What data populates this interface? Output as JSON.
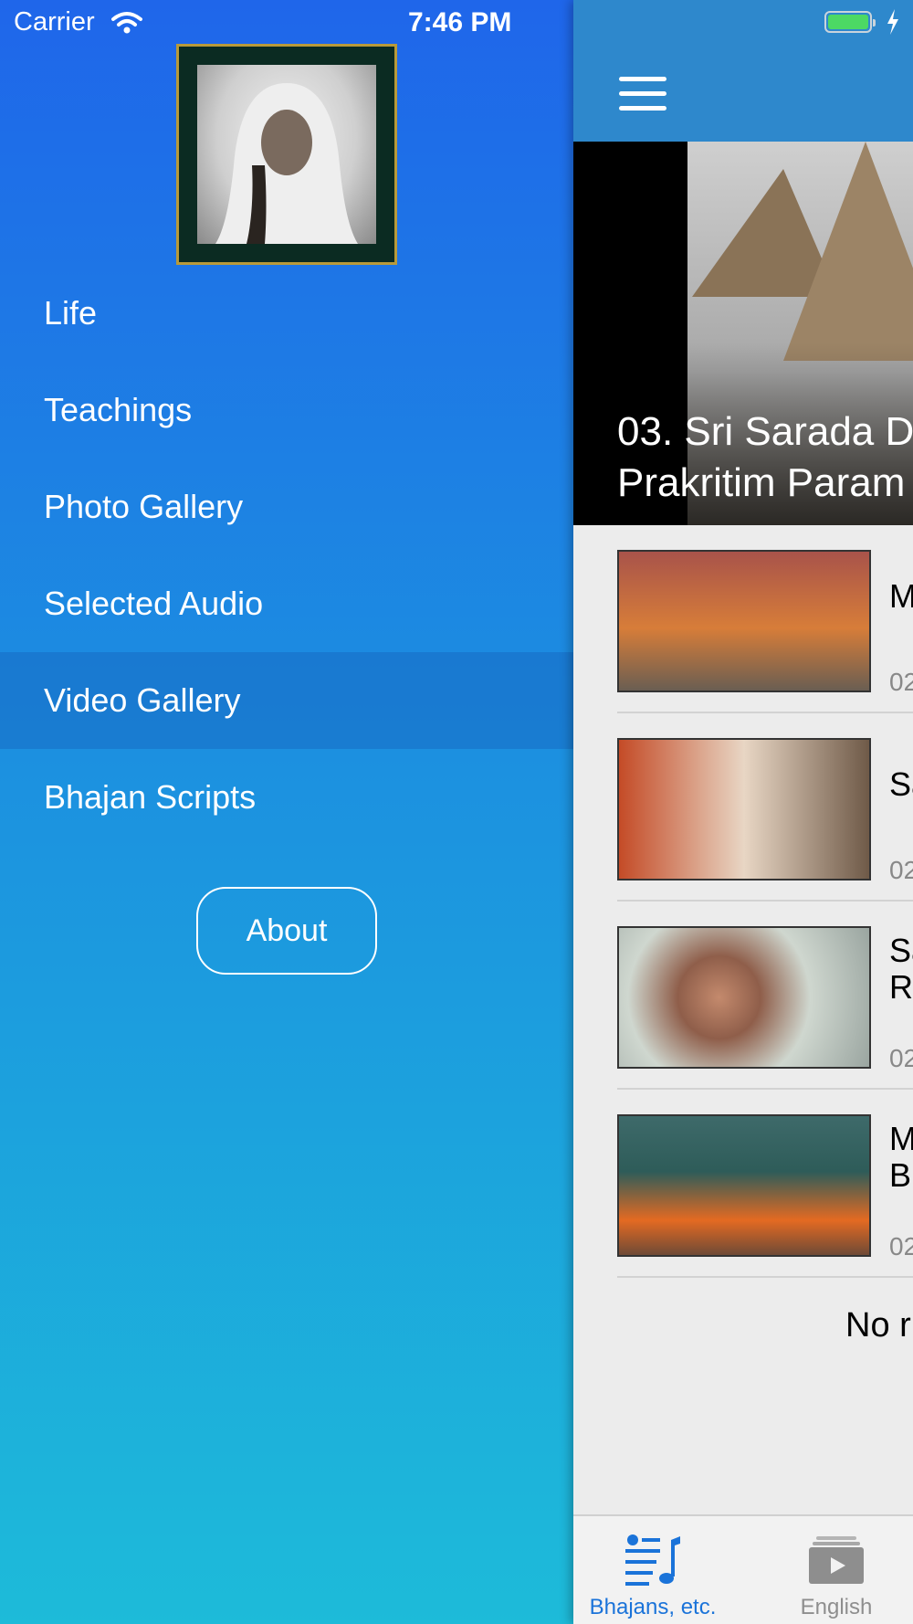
{
  "status_bar": {
    "carrier": "Carrier",
    "time": "7:46 PM"
  },
  "drawer": {
    "menu": [
      {
        "label": "Life"
      },
      {
        "label": "Teachings"
      },
      {
        "label": "Photo Gallery"
      },
      {
        "label": "Selected Audio"
      },
      {
        "label": "Video Gallery",
        "selected": true
      },
      {
        "label": "Bhajan Scripts"
      }
    ],
    "about_label": "About",
    "colors": {
      "gradient_top": "#1f66ea",
      "gradient_bottom": "#1dbbd9"
    }
  },
  "content": {
    "navbar_color": "#2e88cc",
    "hero_title_line1": "03. Sri Sarada D",
    "hero_title_line2": "Prakritim Param",
    "videos": [
      {
        "title": "M",
        "date": "02"
      },
      {
        "title": "Sa",
        "date": "02"
      },
      {
        "title": "Sa\nRa",
        "date": "02"
      },
      {
        "title": "M\nBr",
        "date": "02"
      }
    ],
    "footer_text": "No r",
    "tabs": [
      {
        "label": "Bhajans, etc.",
        "icon": "music-list-icon",
        "selected": true
      },
      {
        "label": "English",
        "icon": "video-play-icon",
        "selected": false
      }
    ],
    "accent": "#1a73d9"
  }
}
